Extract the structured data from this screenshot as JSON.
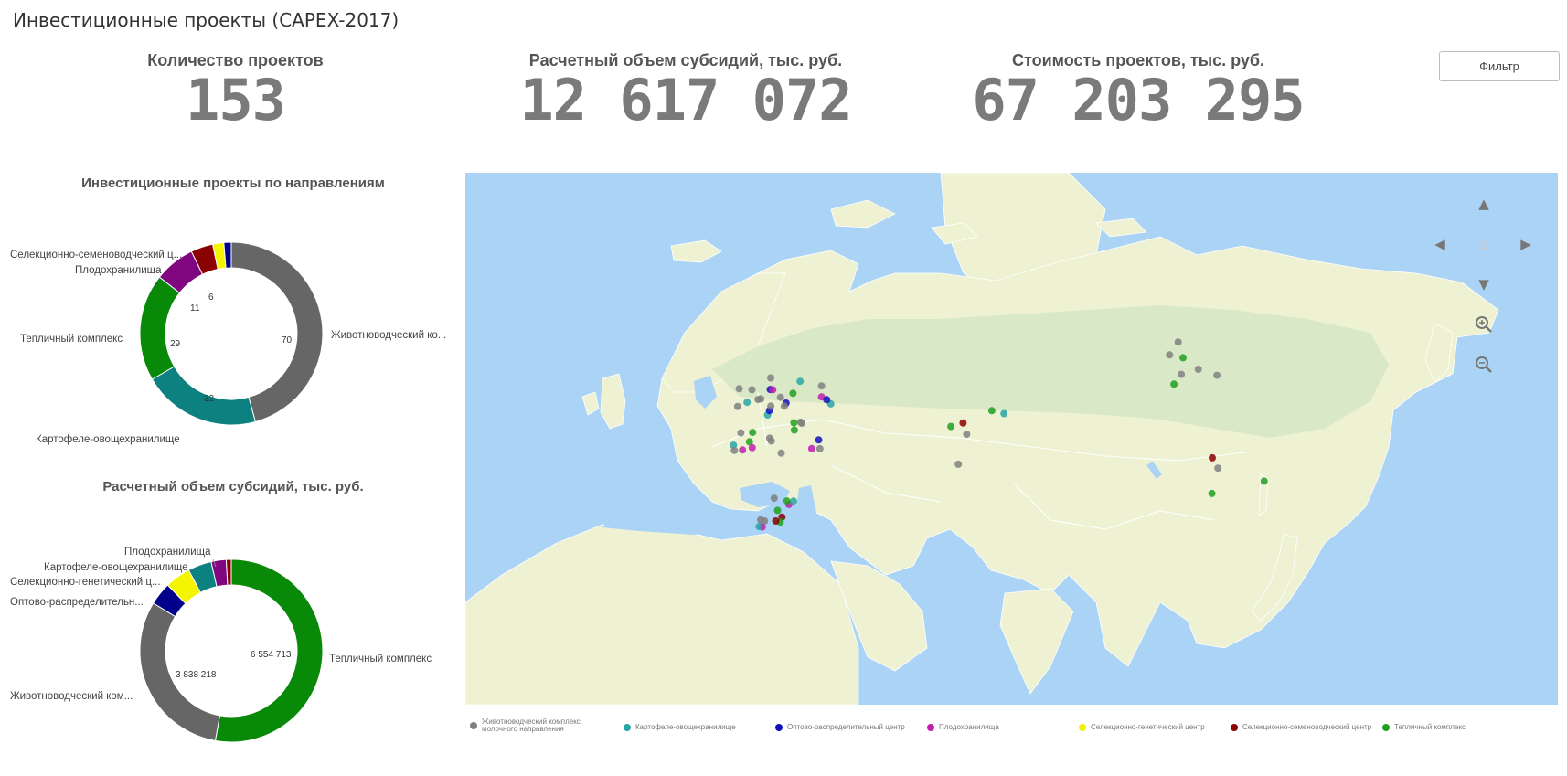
{
  "app": {
    "title": "Инвестиционные проекты (CAPEX-2017)"
  },
  "kpis": [
    {
      "label": "Количество проектов",
      "value": "153"
    },
    {
      "label": "Расчетный объем субсидий, тыс. руб.",
      "value": "12 617 072"
    },
    {
      "label": "Стоимость проектов, тыс. руб.",
      "value": "67 203 295"
    }
  ],
  "filter_button": {
    "label": "Фильтр"
  },
  "donut_by_direction": {
    "title": "Инвестиционные проекты по направлениям",
    "labels": {
      "livestock": "Животноводческий ко...",
      "potato": "Картофеле-овощехранилище",
      "greenhouse": "Тепличный комплекс",
      "fruit": "Плодохранилища",
      "seed": "Селекционно-семеноводческий ц..."
    },
    "values": {
      "livestock": "70",
      "potato": "32",
      "greenhouse": "29",
      "fruit": "11",
      "seed": "6"
    }
  },
  "donut_by_subsidy": {
    "title": "Расчетный объем субсидий, тыс. руб.",
    "labels": {
      "fruit": "Плодохранилища",
      "potato": "Картофеле-овощехранилище",
      "genetic": "Селекционно-генетический ц...",
      "wholesale": "Оптово-распределительн...",
      "livestock": "Животноводческий ком...",
      "greenhouse": "Тепличный комплекс"
    },
    "values": {
      "greenhouse": "6 554 713",
      "livestock": "3 838 218"
    }
  },
  "chart_data": [
    {
      "type": "pie",
      "title": "Инвестиционные проекты по направлениям",
      "categories": [
        "Животноводческий комплекс",
        "Картофеле-овощехранилище",
        "Тепличный комплекс",
        "Плодохранилища",
        "Селекционно-семеноводческий центр",
        "Селекционно-генетический центр",
        "Оптово-распределительный центр"
      ],
      "values": [
        70,
        32,
        29,
        11,
        6,
        3,
        2
      ],
      "colors": [
        "#666666",
        "#0d8080",
        "#088a08",
        "#7f067f",
        "#8b0000",
        "#f5f500",
        "#00008b"
      ]
    },
    {
      "type": "pie",
      "title": "Расчетный объем субсидий, тыс. руб.",
      "categories": [
        "Тепличный комплекс",
        "Животноводческий комплекс",
        "Оптово-распределительный центр",
        "Селекционно-генетический центр",
        "Картофеле-овощехранилище",
        "Плодохранилища",
        "Селекционно-семеноводческий центр"
      ],
      "values": [
        6554713,
        3838218,
        500000,
        560000,
        520000,
        330000,
        110000
      ],
      "colors": [
        "#088a08",
        "#666666",
        "#00008b",
        "#f5f500",
        "#0d8080",
        "#7f067f",
        "#8b0000"
      ]
    }
  ],
  "map": {
    "controls": [
      "arrow-up",
      "arrow-left",
      "home",
      "arrow-right",
      "arrow-down",
      "zoom-in",
      "zoom-out"
    ],
    "colors": {
      "water": "#aad3f5",
      "land": "#eef2d3",
      "forest": "#d5e8c4",
      "borders": "#ffffff"
    }
  },
  "legend": [
    {
      "label": "Животноводческий комплекс молочного направления",
      "color": "#808080"
    },
    {
      "label": "Картофеле-овощехранилище",
      "color": "#2aa5a5"
    },
    {
      "label": "Оптово-распределительный центр",
      "color": "#1010c0"
    },
    {
      "label": "Плодохранилища",
      "color": "#c020b0"
    },
    {
      "label": "Селекционно-генетический центр",
      "color": "#f0f000"
    },
    {
      "label": "Селекционно-семеноводческий центр",
      "color": "#8b0000"
    },
    {
      "label": "Тепличный комплекс",
      "color": "#20a020"
    }
  ]
}
